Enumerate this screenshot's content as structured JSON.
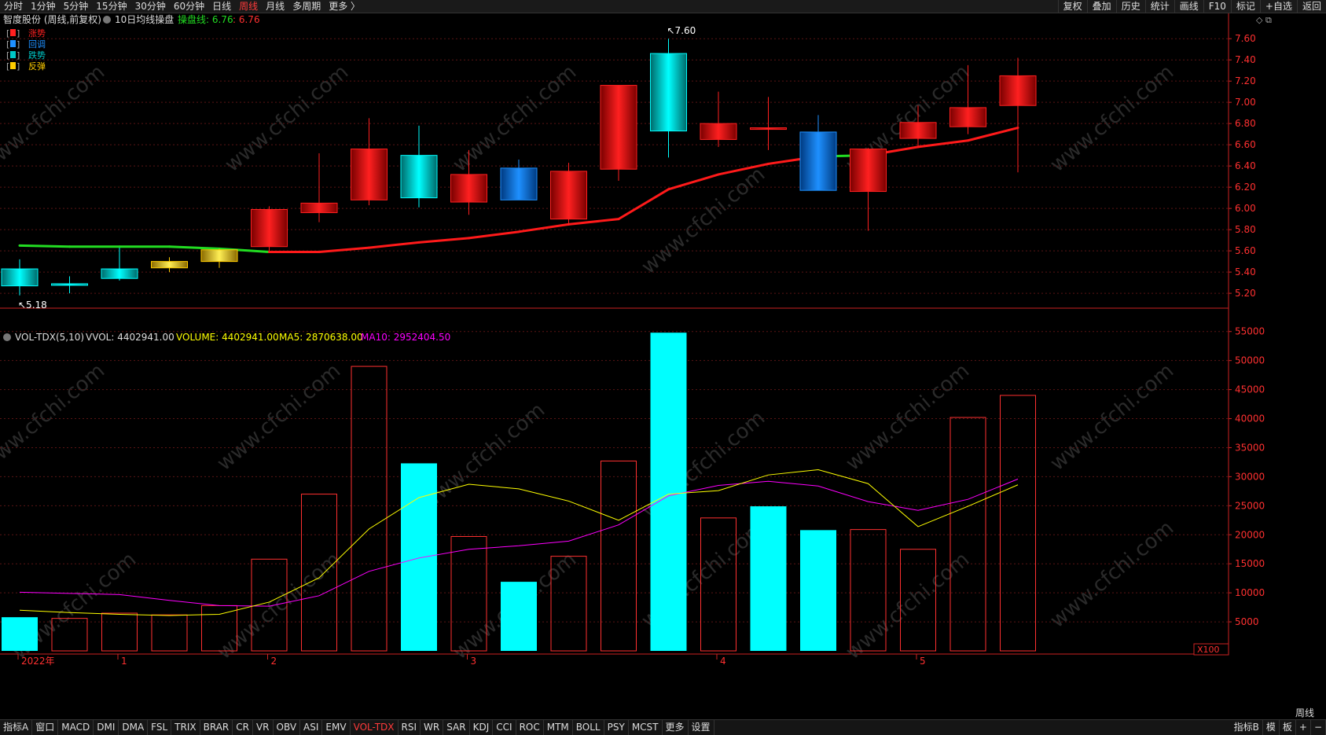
{
  "top_menu": {
    "left": [
      "分时",
      "1分钟",
      "5分钟",
      "15分钟",
      "30分钟",
      "60分钟",
      "日线",
      "周线",
      "月线",
      "多周期",
      "更多 〉"
    ],
    "active_index": 7,
    "right": [
      "复权",
      "叠加",
      "历史",
      "统计",
      "画线",
      "F10",
      "标记",
      "+自选",
      "返回"
    ]
  },
  "price_header": {
    "title": "智度股份 (周线,前复权)",
    "indicator": "10日均线操盘",
    "line_label": "操盘线: 6.76",
    "line_value2": ": 6.76"
  },
  "legend": [
    {
      "label": "涨势",
      "color": "#ff2020"
    },
    {
      "label": "回调",
      "color": "#1e90ff"
    },
    {
      "label": "跌势",
      "color": "#00c8c8"
    },
    {
      "label": "反弹",
      "color": "#ffcc00"
    }
  ],
  "vol_header": {
    "name": "VOL-TDX(5,10)",
    "vvol": "VVOL: 4402941.00",
    "volume": "VOLUME: 4402941.00",
    "ma5": "MA5: 2870638.00",
    "ma10": "MA10: 2952404.50"
  },
  "colors": {
    "up": "#ff2020",
    "down": "#00ffff",
    "pullback": "#1e90ff",
    "rebound": "#ffcc00",
    "ma_up": "#ff1a1a",
    "ma_down": "#22dd22",
    "ma5": "#ffff00",
    "ma10": "#ff00ff",
    "axis": "#cc2222",
    "grid": "#5a1414"
  },
  "chart_data": {
    "type": "candlestick",
    "price_axis": {
      "ticks": [
        "7.60",
        "7.40",
        "7.20",
        "7.00",
        "6.80",
        "6.60",
        "6.40",
        "6.20",
        "6.00",
        "5.80",
        "5.60",
        "5.40",
        "5.20"
      ],
      "range": [
        5.06,
        7.72
      ]
    },
    "volume_axis": {
      "ticks": [
        "55000",
        "50000",
        "45000",
        "40000",
        "35000",
        "30000",
        "25000",
        "20000",
        "15000",
        "10000",
        "5000"
      ],
      "range": [
        0,
        57400
      ],
      "unit": "X100"
    },
    "x_labels": [
      {
        "i": 0,
        "text": "2022年"
      },
      {
        "i": 2,
        "text": "1"
      },
      {
        "i": 5,
        "text": "2"
      },
      {
        "i": 9,
        "text": "3"
      },
      {
        "i": 14,
        "text": "4"
      },
      {
        "i": 18,
        "text": "5"
      }
    ],
    "annotations": {
      "high": "7.60",
      "low": "5.18"
    },
    "candles": [
      {
        "o": 5.43,
        "h": 5.52,
        "l": 5.18,
        "c": 5.27,
        "t": "down"
      },
      {
        "o": 5.29,
        "h": 5.36,
        "l": 5.2,
        "c": 5.28,
        "t": "down"
      },
      {
        "o": 5.34,
        "h": 5.63,
        "l": 5.32,
        "c": 5.43,
        "t": "down"
      },
      {
        "o": 5.44,
        "h": 5.54,
        "l": 5.4,
        "c": 5.5,
        "t": "rebound"
      },
      {
        "o": 5.5,
        "h": 5.62,
        "l": 5.44,
        "c": 5.61,
        "t": "rebound"
      },
      {
        "o": 5.64,
        "h": 6.02,
        "l": 5.6,
        "c": 5.99,
        "t": "up"
      },
      {
        "o": 5.96,
        "h": 6.52,
        "l": 5.87,
        "c": 6.05,
        "t": "up"
      },
      {
        "o": 6.08,
        "h": 6.85,
        "l": 6.03,
        "c": 6.56,
        "t": "up"
      },
      {
        "o": 6.5,
        "h": 6.78,
        "l": 6.01,
        "c": 6.1,
        "t": "down"
      },
      {
        "o": 6.32,
        "h": 6.55,
        "l": 5.94,
        "c": 6.06,
        "t": "up"
      },
      {
        "o": 6.08,
        "h": 6.46,
        "l": 6.08,
        "c": 6.38,
        "t": "pullback"
      },
      {
        "o": 5.9,
        "h": 6.43,
        "l": 5.84,
        "c": 6.35,
        "t": "up"
      },
      {
        "o": 6.37,
        "h": 7.16,
        "l": 6.26,
        "c": 7.16,
        "t": "up"
      },
      {
        "o": 7.46,
        "h": 7.6,
        "l": 6.48,
        "c": 6.73,
        "t": "down"
      },
      {
        "o": 6.65,
        "h": 7.1,
        "l": 6.58,
        "c": 6.8,
        "t": "up"
      },
      {
        "o": 6.76,
        "h": 7.05,
        "l": 6.55,
        "c": 6.76,
        "t": "up"
      },
      {
        "o": 6.72,
        "h": 6.88,
        "l": 6.17,
        "c": 6.17,
        "t": "pullback"
      },
      {
        "o": 6.56,
        "h": 6.57,
        "l": 5.79,
        "c": 6.16,
        "t": "up"
      },
      {
        "o": 6.66,
        "h": 6.97,
        "l": 6.58,
        "c": 6.81,
        "t": "up"
      },
      {
        "o": 6.77,
        "h": 7.35,
        "l": 6.7,
        "c": 6.95,
        "t": "up"
      },
      {
        "o": 6.97,
        "h": 7.42,
        "l": 6.34,
        "c": 7.25,
        "t": "up"
      }
    ],
    "ma10_line": [
      5.65,
      5.64,
      5.64,
      5.64,
      5.62,
      5.59,
      5.59,
      5.63,
      5.68,
      5.72,
      5.78,
      5.85,
      5.9,
      6.18,
      6.32,
      6.42,
      6.49,
      6.5,
      6.58,
      6.64,
      6.76
    ],
    "ma10_line_color": [
      "down",
      "down",
      "down",
      "down",
      "down",
      "down",
      "up",
      "up",
      "up",
      "up",
      "up",
      "up",
      "up",
      "up",
      "up",
      "up",
      "up",
      "down",
      "up",
      "up",
      "up"
    ],
    "volume": [
      {
        "v": 5800,
        "t": "down"
      },
      {
        "v": 5600,
        "t": "up"
      },
      {
        "v": 6500,
        "t": "up"
      },
      {
        "v": 6200,
        "t": "up"
      },
      {
        "v": 7800,
        "t": "up"
      },
      {
        "v": 15800,
        "t": "up"
      },
      {
        "v": 27000,
        "t": "up"
      },
      {
        "v": 49000,
        "t": "up"
      },
      {
        "v": 32300,
        "t": "down"
      },
      {
        "v": 19700,
        "t": "up"
      },
      {
        "v": 11900,
        "t": "down"
      },
      {
        "v": 16300,
        "t": "up"
      },
      {
        "v": 32700,
        "t": "up"
      },
      {
        "v": 54800,
        "t": "down"
      },
      {
        "v": 22900,
        "t": "up"
      },
      {
        "v": 24900,
        "t": "down"
      },
      {
        "v": 20800,
        "t": "down"
      },
      {
        "v": 20900,
        "t": "up"
      },
      {
        "v": 17500,
        "t": "up"
      },
      {
        "v": 40200,
        "t": "up"
      },
      {
        "v": 44000,
        "t": "up"
      }
    ],
    "ma5_series": [
      7000,
      6600,
      6300,
      6100,
      6300,
      8400,
      12600,
      21000,
      26400,
      28700,
      27900,
      25800,
      22500,
      27000,
      27600,
      30300,
      31200,
      28800,
      21400,
      24900,
      28600
    ],
    "ma10_series": [
      10100,
      9900,
      9700,
      8700,
      7800,
      7700,
      9500,
      13700,
      16000,
      17500,
      18100,
      18900,
      21700,
      26700,
      28500,
      29200,
      28400,
      25700,
      24200,
      26100,
      29600
    ],
    "ma5_start": 0,
    "ma10_start": 0
  },
  "bottom_tabs": [
    "指标A",
    "窗口",
    "MACD",
    "DMI",
    "DMA",
    "FSL",
    "TRIX",
    "BRAR",
    "CR",
    "VR",
    "OBV",
    "ASI",
    "EMV",
    "VOL-TDX",
    "RSI",
    "WR",
    "SAR",
    "KDJ",
    "CCI",
    "ROC",
    "MTM",
    "BOLL",
    "PSY",
    "MCST",
    "更多",
    "设置"
  ],
  "bottom_active": 13,
  "bottom_right": [
    "指标B",
    "模",
    "板",
    "+",
    "−"
  ],
  "right_label": "周线",
  "watermark": "www.cfchi.com"
}
